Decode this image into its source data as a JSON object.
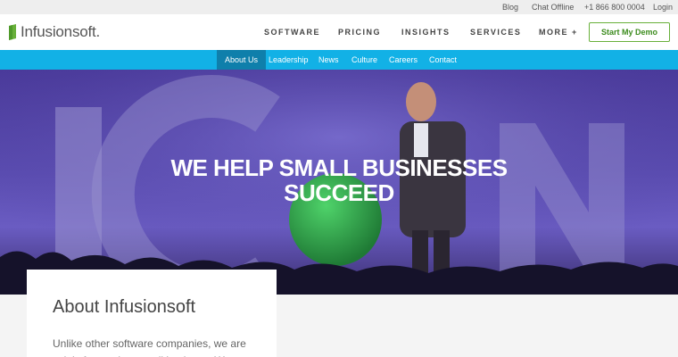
{
  "utility": {
    "blog": "Blog",
    "chat": "Chat Offline",
    "phone": "+1 866 800 0004",
    "login": "Login"
  },
  "brand": {
    "name": "Infusionsoft.",
    "color": "#68b03a"
  },
  "nav": {
    "software": "SOFTWARE",
    "pricing": "PRICING",
    "insights": "INSIGHTS",
    "services": "SERVICES",
    "more": "MORE +",
    "cta": "Start My Demo"
  },
  "subnav": {
    "about": "About Us",
    "leadership": "Leadership",
    "news": "News",
    "culture": "Culture",
    "careers": "Careers",
    "contact": "Contact",
    "color": "#12b1e6",
    "active_color": "#0f7fab"
  },
  "hero": {
    "title_line1": "WE HELP SMALL BUSINESSES",
    "title_line2": "SUCCEED"
  },
  "about": {
    "title": "About Infusionsoft",
    "body": "Unlike other software companies, we are solely focused on small business. We"
  }
}
